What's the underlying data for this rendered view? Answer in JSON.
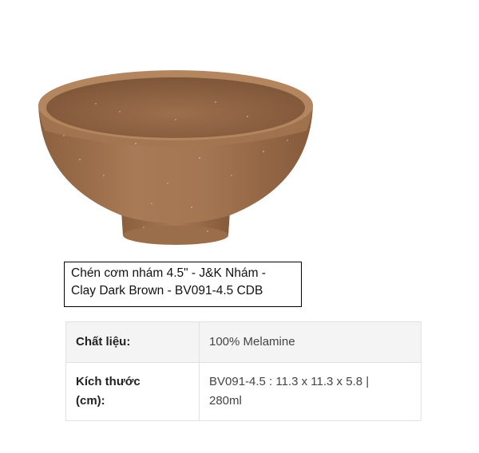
{
  "caption": {
    "line1": "Chén cơm nhám 4.5\" - J&K Nhám -",
    "line2": "Clay Dark Brown - BV091-4.5 CDB"
  },
  "specs": [
    {
      "label_line1": "Chất liệu:",
      "label_line2": "",
      "value_line1": "100% Melamine",
      "value_line2": ""
    },
    {
      "label_line1": "Kích thước",
      "label_line2": "(cm):",
      "value_line1": "BV091-4.5 : 11.3 x 11.3 x 5.8 |",
      "value_line2": "280ml"
    }
  ],
  "colors": {
    "bowl_clay": "#a27350",
    "bowl_rim": "#b7875f",
    "bowl_inner": "#8f6444",
    "table_border": "#e1e1e1",
    "row_shade": "#f4f4f4"
  }
}
